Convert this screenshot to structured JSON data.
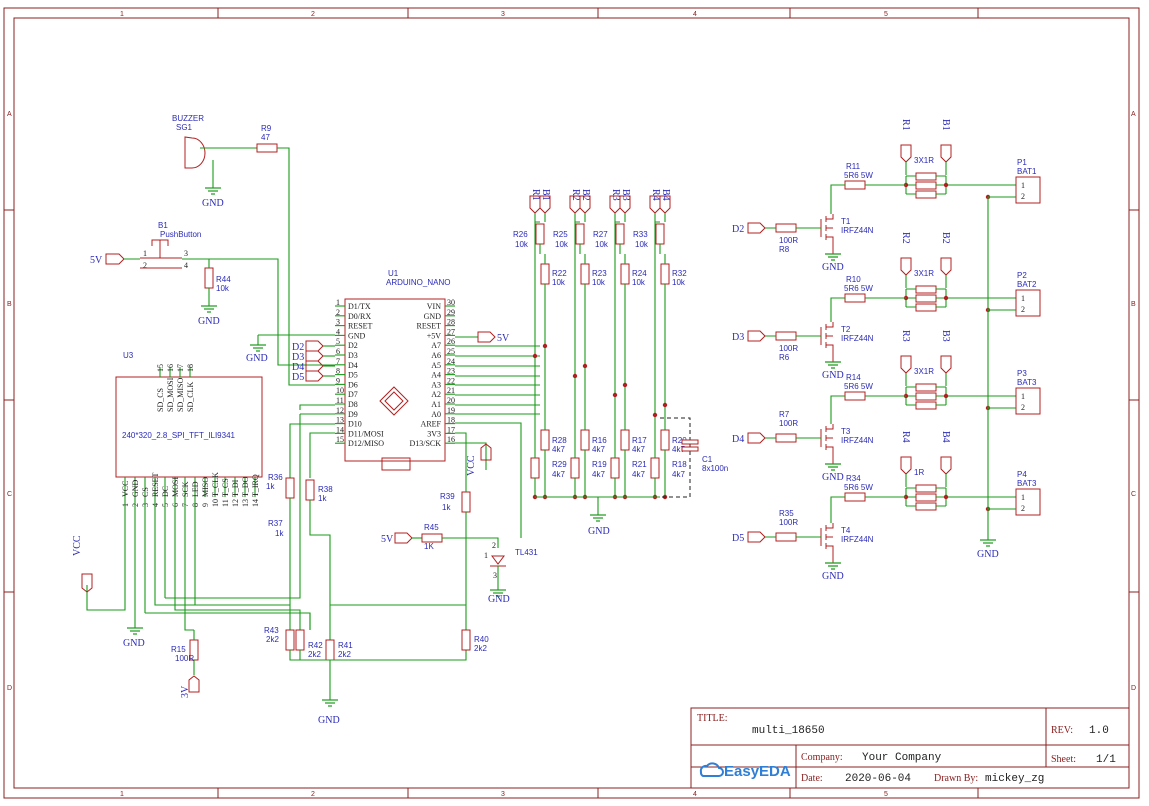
{
  "frame": {
    "columns": [
      "1",
      "2",
      "3",
      "4",
      "5"
    ],
    "rows": [
      "A",
      "B",
      "C",
      "D"
    ]
  },
  "components": {
    "buzzer": {
      "ref": "SG1",
      "value": "BUZZER"
    },
    "pushbutton": {
      "ref": "B1",
      "value": "PushButton"
    },
    "arduino": {
      "ref": "U1",
      "value": "ARDUINO_NANO",
      "left_pins": [
        {
          "num": "1",
          "name": "D1/TX"
        },
        {
          "num": "2",
          "name": "D0/RX"
        },
        {
          "num": "3",
          "name": "RESET"
        },
        {
          "num": "4",
          "name": "GND"
        },
        {
          "num": "5",
          "name": "D2"
        },
        {
          "num": "6",
          "name": "D3"
        },
        {
          "num": "7",
          "name": "D4"
        },
        {
          "num": "8",
          "name": "D5"
        },
        {
          "num": "9",
          "name": "D6"
        },
        {
          "num": "10",
          "name": "D7"
        },
        {
          "num": "11",
          "name": "D8"
        },
        {
          "num": "12",
          "name": "D9"
        },
        {
          "num": "13",
          "name": "D10"
        },
        {
          "num": "14",
          "name": "D11/MOSI"
        },
        {
          "num": "15",
          "name": "D12/MISO"
        }
      ],
      "right_pins": [
        {
          "num": "30",
          "name": "VIN"
        },
        {
          "num": "29",
          "name": "GND"
        },
        {
          "num": "28",
          "name": "RESET"
        },
        {
          "num": "27",
          "name": "+5V"
        },
        {
          "num": "26",
          "name": "A7"
        },
        {
          "num": "25",
          "name": "A6"
        },
        {
          "num": "24",
          "name": "A5"
        },
        {
          "num": "23",
          "name": "A4"
        },
        {
          "num": "22",
          "name": "A3"
        },
        {
          "num": "21",
          "name": "A2"
        },
        {
          "num": "20",
          "name": "A1"
        },
        {
          "num": "19",
          "name": "A0"
        },
        {
          "num": "18",
          "name": "AREF"
        },
        {
          "num": "17",
          "name": "3V3"
        },
        {
          "num": "16",
          "name": "D13/SCK"
        }
      ]
    },
    "display": {
      "ref": "U3",
      "value": "240*320_2.8_SPI_TFT_ILI9341",
      "top_pins": [
        "15",
        "16",
        "17",
        "18"
      ],
      "top_names": [
        "SD_CS",
        "SD_MOSI",
        "SD_MISO",
        "SD_CLK"
      ],
      "bottom_pins": [
        "1",
        "2",
        "3",
        "4",
        "5",
        "6",
        "7",
        "8",
        "9",
        "10",
        "11",
        "12",
        "13",
        "14"
      ],
      "bottom_names": [
        "VCC",
        "GND",
        "CS",
        "RESET",
        "DC",
        "MOSI",
        "SCK",
        "LED",
        "MISO",
        "T_CLK",
        "T_CS",
        "T_DI",
        "T_DO",
        "T_IRQ"
      ]
    },
    "tl431": {
      "ref": "TL431",
      "pins": [
        "2",
        "1",
        "3"
      ]
    },
    "capacitor": {
      "ref": "C1",
      "value": "8x100n"
    },
    "resistors": [
      {
        "ref": "R9",
        "value": "47"
      },
      {
        "ref": "R44",
        "value": "10k"
      },
      {
        "ref": "R26",
        "value": "10k"
      },
      {
        "ref": "R25",
        "value": "10k"
      },
      {
        "ref": "R27",
        "value": "10k"
      },
      {
        "ref": "R33",
        "value": "10k"
      },
      {
        "ref": "R22",
        "value": "10k"
      },
      {
        "ref": "R23",
        "value": "10k"
      },
      {
        "ref": "R24",
        "value": "10k"
      },
      {
        "ref": "R32",
        "value": "10k"
      },
      {
        "ref": "R28",
        "value": "4k7"
      },
      {
        "ref": "R16",
        "value": "4k7"
      },
      {
        "ref": "R17",
        "value": "4k7"
      },
      {
        "ref": "R20",
        "value": "4k7"
      },
      {
        "ref": "R29",
        "value": "4k7"
      },
      {
        "ref": "R19",
        "value": "4k7"
      },
      {
        "ref": "R21",
        "value": "4k7"
      },
      {
        "ref": "R18",
        "value": "4k7"
      },
      {
        "ref": "R36",
        "value": "1k"
      },
      {
        "ref": "R38",
        "value": "1k"
      },
      {
        "ref": "R37",
        "value": "1k"
      },
      {
        "ref": "R39",
        "value": "1k"
      },
      {
        "ref": "R45",
        "value": "1K"
      },
      {
        "ref": "R15",
        "value": "100R"
      },
      {
        "ref": "R43",
        "value": "2k2"
      },
      {
        "ref": "R42",
        "value": "2k2"
      },
      {
        "ref": "R41",
        "value": "2k2"
      },
      {
        "ref": "R40",
        "value": "2k2"
      },
      {
        "ref": "R11",
        "value": "5R6 5W"
      },
      {
        "ref": "R10",
        "value": "5R6 5W"
      },
      {
        "ref": "R14",
        "value": "5R6 5W"
      },
      {
        "ref": "R34",
        "value": "5R6 5W"
      },
      {
        "ref": "R8",
        "value": "100R"
      },
      {
        "ref": "R6",
        "value": "100R"
      },
      {
        "ref": "R7",
        "value": "100R"
      },
      {
        "ref": "R35",
        "value": "100R"
      }
    ],
    "load_banks": [
      "3X1R",
      "3X1R",
      "3X1R",
      "1R"
    ],
    "mosfets": [
      {
        "ref": "T1",
        "value": "IRFZ44N"
      },
      {
        "ref": "T2",
        "value": "IRFZ44N"
      },
      {
        "ref": "T3",
        "value": "IRFZ44N"
      },
      {
        "ref": "T4",
        "value": "IRFZ44N"
      }
    ],
    "batteries": [
      {
        "ref": "P1",
        "value": "BAT1"
      },
      {
        "ref": "P2",
        "value": "BAT2"
      },
      {
        "ref": "P3",
        "value": "BAT3"
      },
      {
        "ref": "P4",
        "value": "BAT3"
      }
    ],
    "conn_pins": [
      "1",
      "2"
    ]
  },
  "nets": {
    "gnd": "GND",
    "v5": "5V",
    "v5_plus": "5V",
    "vcc": "VCC",
    "v3": "3V",
    "d2": "D2",
    "d3": "D3",
    "d4": "D4",
    "d5": "D5",
    "r1": "R1",
    "b1": "B1",
    "r2": "R2",
    "b2": "B2",
    "r3": "R3",
    "b3": "B3",
    "r4": "R4",
    "b4": "B4"
  },
  "title_block": {
    "title_label": "TITLE:",
    "title": "multi_18650",
    "rev_label": "REV:",
    "rev": "1.0",
    "company_label": "Company:",
    "company": "Your Company",
    "sheet_label": "Sheet:",
    "sheet": "1/1",
    "date_label": "Date:",
    "date": "2020-06-04",
    "drawn_label": "Drawn By:",
    "drawn_by": "mickey_zg",
    "logo": "EasyEDA"
  },
  "colors": {
    "wire": "#1a9a1a",
    "symbol": "#b02020",
    "label": "#2b2bb8",
    "frame": "#8a2020"
  }
}
